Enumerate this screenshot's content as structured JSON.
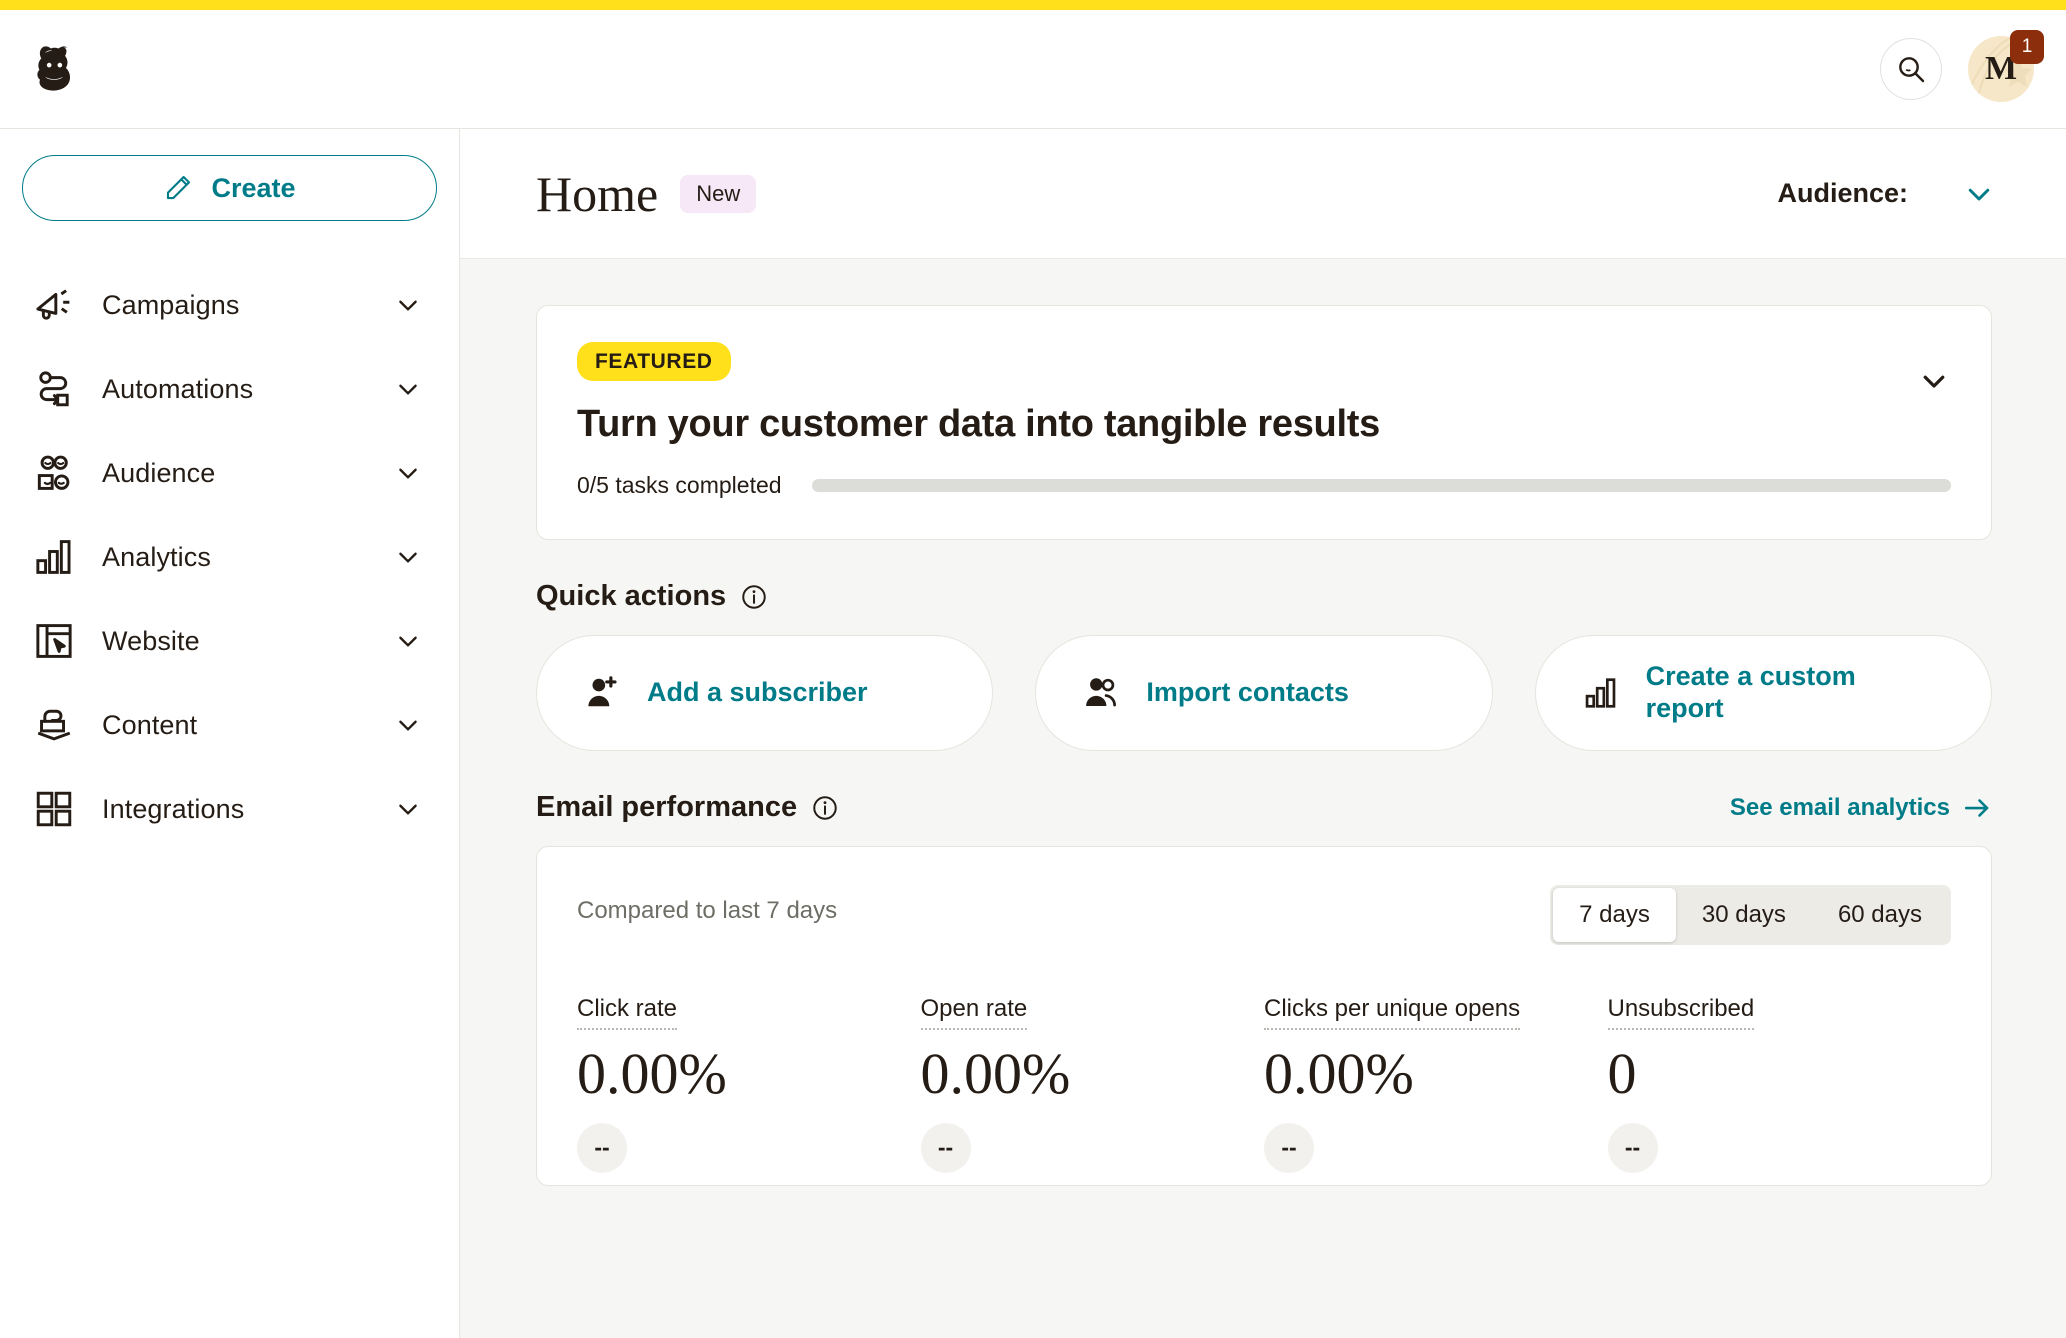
{
  "brand": {
    "accent_yellow": "#FFE01B",
    "accent_teal": "#007C89",
    "badge_red": "#8C2E0B"
  },
  "topbar": {
    "logo_name": "mailchimp-freddie-logo",
    "search_label": "search-icon",
    "avatar_initial": "M",
    "notification_count": "1"
  },
  "sidebar": {
    "create_label": "Create",
    "items": [
      {
        "label": "Campaigns",
        "icon": "megaphone-icon"
      },
      {
        "label": "Automations",
        "icon": "automation-path-icon"
      },
      {
        "label": "Audience",
        "icon": "people-group-icon"
      },
      {
        "label": "Analytics",
        "icon": "bar-chart-icon"
      },
      {
        "label": "Website",
        "icon": "browser-cursor-icon"
      },
      {
        "label": "Content",
        "icon": "content-layers-icon"
      },
      {
        "label": "Integrations",
        "icon": "grid-squares-icon"
      }
    ]
  },
  "page_head": {
    "title": "Home",
    "badge": "New",
    "audience_label": "Audience:",
    "audience_value": ""
  },
  "featured": {
    "badge": "FEATURED",
    "title": "Turn your customer data into tangible results",
    "tasks_text": "0/5 tasks completed",
    "progress_percent": 0
  },
  "quick_actions": {
    "title": "Quick actions",
    "cards": [
      {
        "label": "Add a subscriber",
        "icon": "user-plus-icon"
      },
      {
        "label": "Import contacts",
        "icon": "users-icon"
      },
      {
        "label": "Create a custom report",
        "icon": "bar-chart-icon"
      }
    ]
  },
  "email_performance": {
    "title": "Email performance",
    "see_link": "See email analytics",
    "compared_text": "Compared to last 7 days",
    "ranges": [
      {
        "label": "7 days",
        "active": true
      },
      {
        "label": "30 days",
        "active": false
      },
      {
        "label": "60 days",
        "active": false
      }
    ],
    "metrics": [
      {
        "label": "Click rate",
        "value": "0.00%",
        "delta": "--"
      },
      {
        "label": "Open rate",
        "value": "0.00%",
        "delta": "--"
      },
      {
        "label": "Clicks per unique opens",
        "value": "0.00%",
        "delta": "--"
      },
      {
        "label": "Unsubscribed",
        "value": "0",
        "delta": "--"
      }
    ]
  }
}
